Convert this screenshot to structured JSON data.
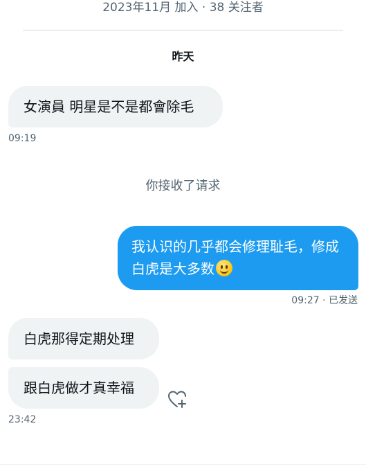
{
  "conversation": {
    "header_meta": "2023年11月 加入 · 38 关注者",
    "day_label": "昨天",
    "system_message": "你接收了请求"
  },
  "messages": [
    {
      "direction": "in",
      "text": "女演員 明星是不是都會除毛",
      "time": "09:19"
    },
    {
      "direction": "out",
      "text": "我认识的几乎都会修理耻毛，修成白虎是大多数",
      "emoji": "slightly-smiling-face-emoji",
      "time": "09:27 · 已发送"
    },
    {
      "direction": "in",
      "text": "白虎那得定期处理"
    },
    {
      "direction": "in",
      "text": "跟白虎做才真幸福",
      "time": "23:42"
    }
  ],
  "icons": {
    "react": "heart-plus-icon"
  },
  "colors": {
    "outgoing_bubble": "#1d9bf0",
    "incoming_bubble": "#eff3f4",
    "secondary_text": "#536471"
  }
}
